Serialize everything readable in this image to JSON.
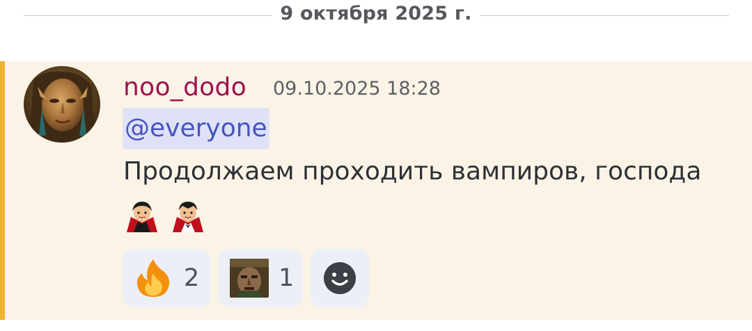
{
  "date_divider": {
    "label": "9 октября 2025 г."
  },
  "message": {
    "author": "noo_dodo",
    "timestamp": "09.10.2025 18:28",
    "mention": "@everyone",
    "text": "Продолжаем проходить вампиров, господа",
    "emojis": [
      "woman-vampire-icon",
      "man-vampire-icon"
    ],
    "author_color": "#a0104f",
    "mention_color": "#4654c0",
    "highlight_bar_color": "#f0b232"
  },
  "reactions": [
    {
      "icon": "fire-icon",
      "count": "2"
    },
    {
      "icon": "zombie-face-icon",
      "count": "1"
    },
    {
      "icon": "add-reaction-icon"
    }
  ]
}
